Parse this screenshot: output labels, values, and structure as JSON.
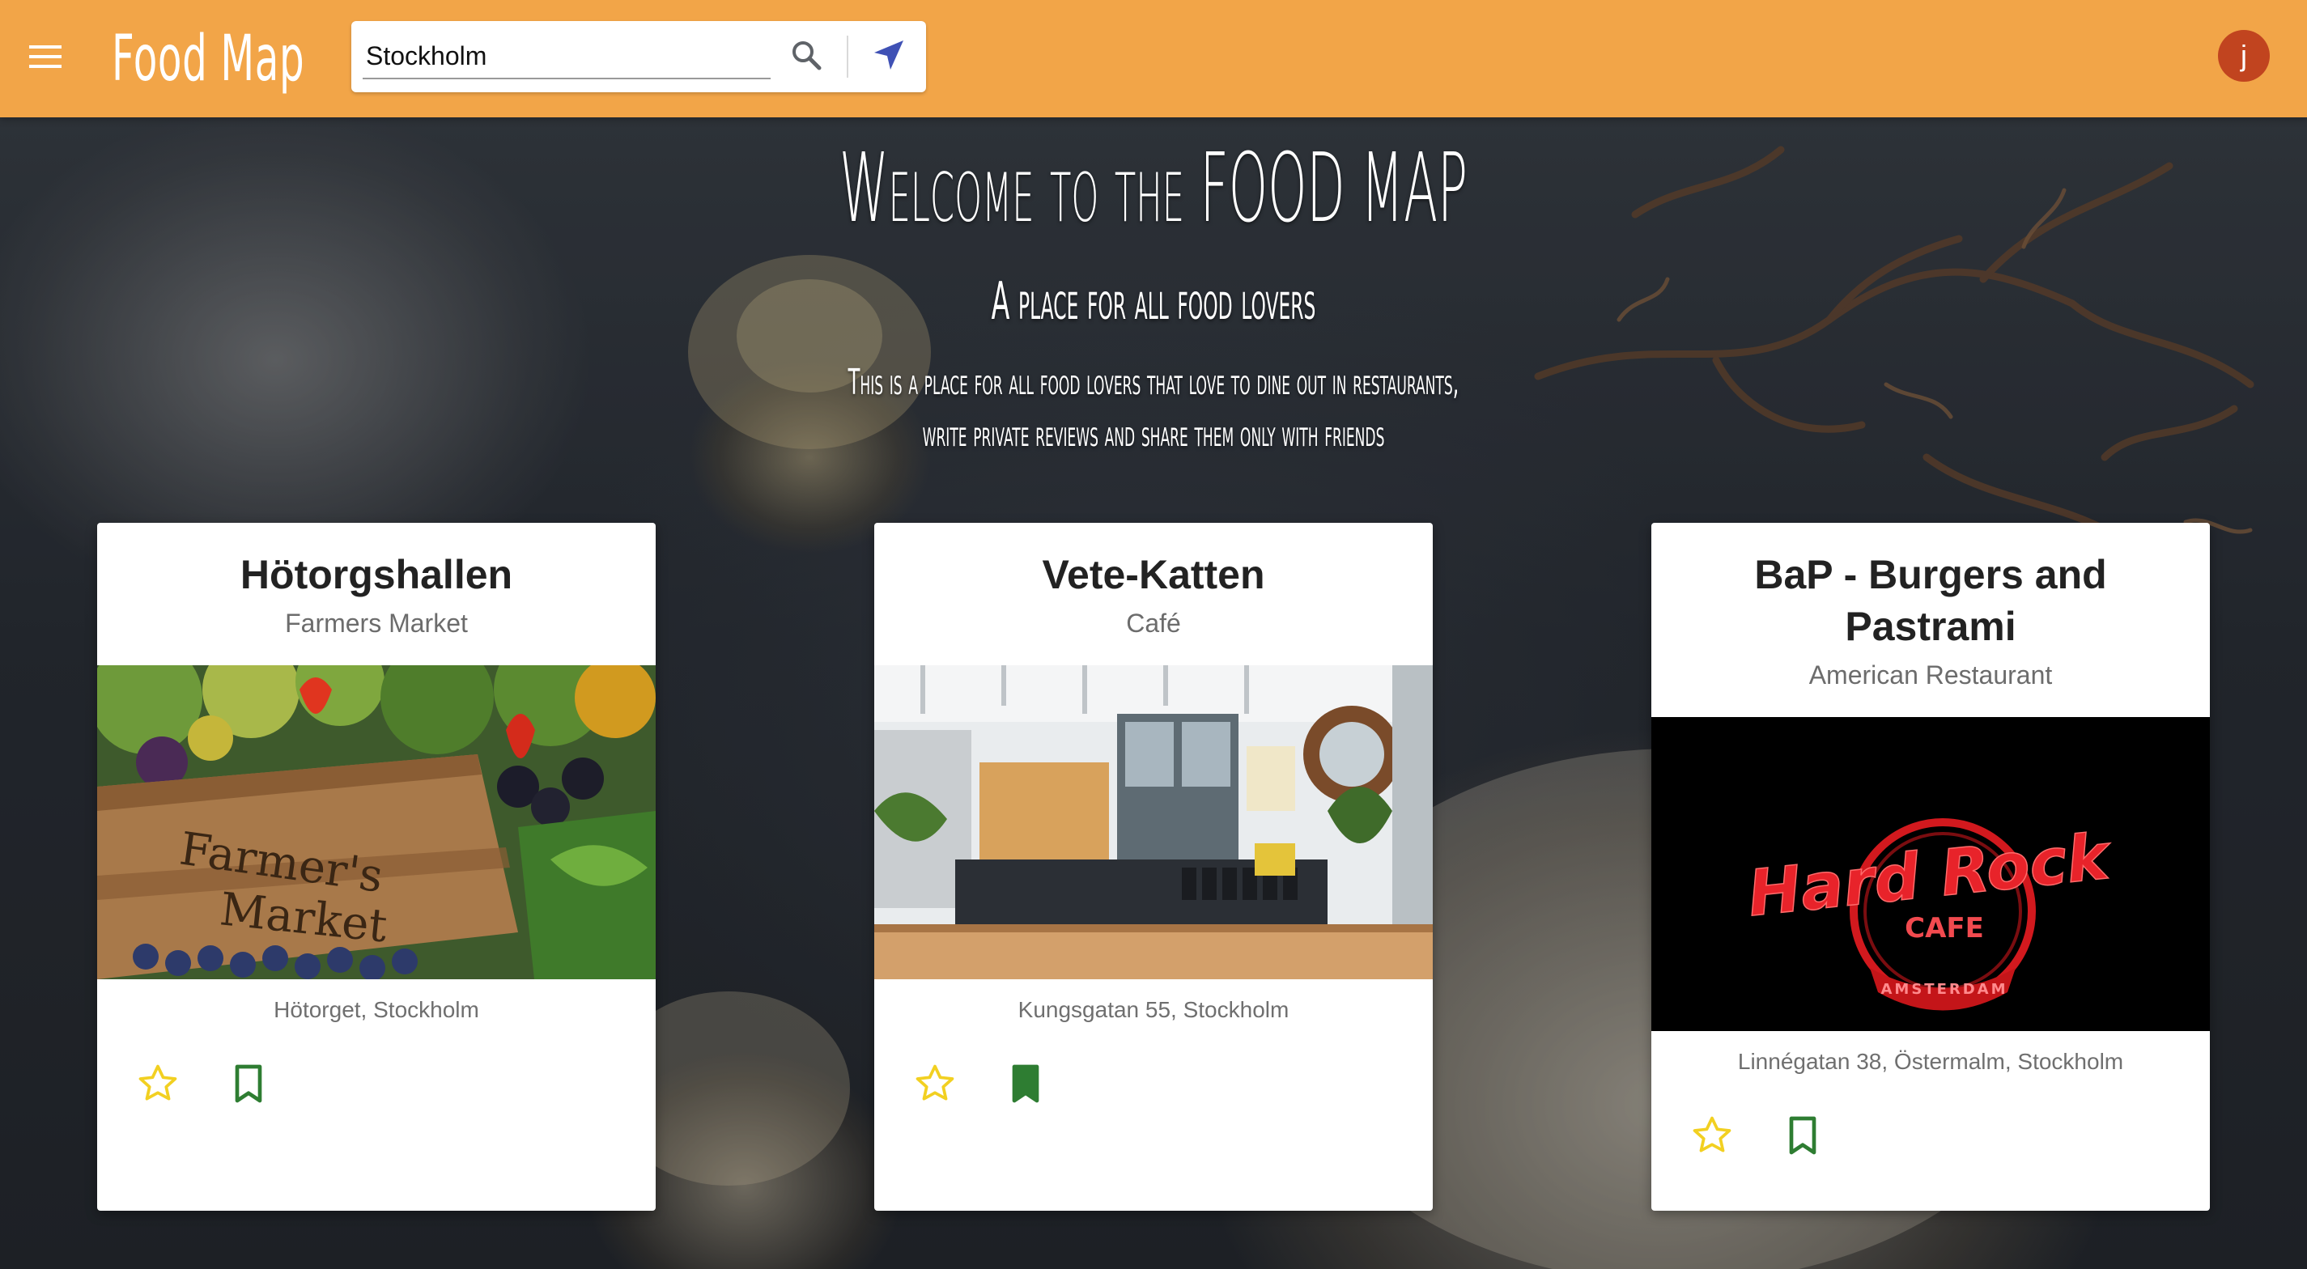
{
  "topbar": {
    "menu_icon": "menu-icon",
    "brand": "Food Map",
    "search": {
      "value": "Stockholm",
      "placeholder": "",
      "search_icon": "search-icon",
      "locate_icon": "navigation-arrow-icon"
    },
    "avatar_letter": "j",
    "colors": {
      "bar": "#f2a548",
      "avatar": "#c1441f",
      "locate": "#3f51b5"
    }
  },
  "hero": {
    "title": "Welcome to the FOOD MAP",
    "subtitle": "A place for all food lovers",
    "description_line1": "This is a place for all food lovers that love to dine out in restaurants,",
    "description_line2": "write private reviews and share them only with friends"
  },
  "cards": [
    {
      "title": "Hötorgshallen",
      "category": "Farmers Market",
      "image": "farmers-market-crate-image",
      "image_text_line1": "Farmer's",
      "image_text_line2": "Market",
      "address": "Hötorget, Stockholm",
      "favorite": false,
      "bookmarked": false
    },
    {
      "title": "Vete-Katten",
      "category": "Café",
      "image": "cafe-interior-image",
      "address": "Kungsgatan 55, Stockholm",
      "favorite": false,
      "bookmarked": true
    },
    {
      "title": "BaP - Burgers and Pastrami",
      "category": "American Restaurant",
      "image": "hard-rock-cafe-neon-logo-image",
      "image_text_line1": "Hard Rock",
      "image_text_line2": "CAFE",
      "image_text_line3": "AMSTERDAM",
      "address": "Linnégatan 38, Östermalm, Stockholm",
      "favorite": false,
      "bookmarked": false
    }
  ],
  "action_colors": {
    "star": "#f2d021",
    "bookmark": "#2e7d32"
  }
}
